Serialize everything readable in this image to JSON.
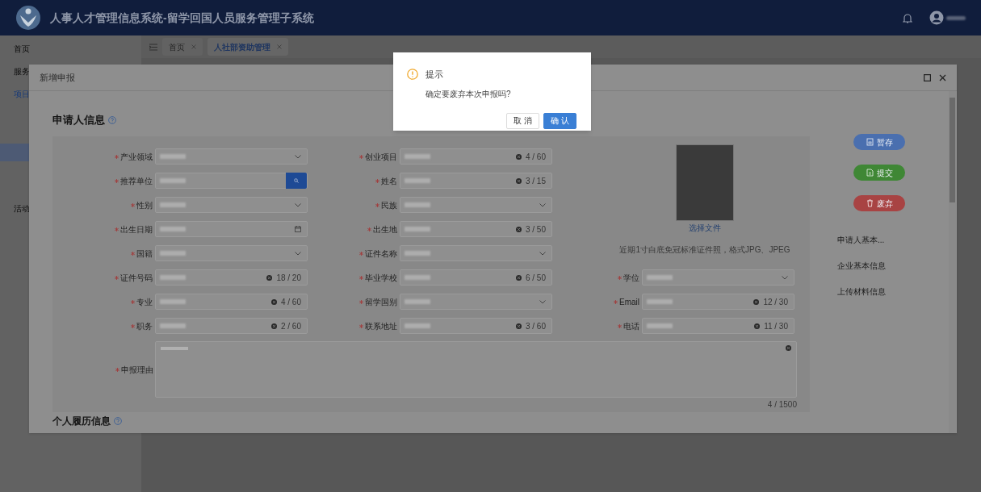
{
  "header": {
    "title": "人事人才管理信息系统-留学回国人员服务管理子系统"
  },
  "sidebar": {
    "items": [
      {
        "label": "首页",
        "selected": false
      },
      {
        "label": "服务",
        "selected": false
      },
      {
        "label": "项目",
        "selected": true
      },
      {
        "label": "活动",
        "selected": false
      }
    ]
  },
  "tabs": [
    {
      "label": "首页",
      "selected": false
    },
    {
      "label": "人社部资助管理",
      "selected": true
    }
  ],
  "dialog": {
    "title": "新增申报",
    "section": {
      "title": "申请人信息"
    },
    "columns": [
      [
        {
          "label": "产业领域",
          "kind": "select",
          "required": true
        },
        {
          "label": "推荐单位",
          "kind": "search",
          "required": true
        },
        {
          "label": "性别",
          "kind": "select",
          "required": true
        },
        {
          "label": "出生日期",
          "kind": "date",
          "required": true
        },
        {
          "label": "国籍",
          "kind": "select",
          "required": true
        },
        {
          "label": "证件号码",
          "kind": "text",
          "required": true,
          "count": "18 / 20"
        },
        {
          "label": "专业",
          "kind": "text",
          "required": true,
          "count": "4 / 60"
        },
        {
          "label": "职务",
          "kind": "text",
          "required": true,
          "count": "2 / 60"
        }
      ],
      [
        {
          "label": "创业项目",
          "kind": "text",
          "required": true,
          "count": "4 / 60"
        },
        {
          "label": "姓名",
          "kind": "text",
          "required": true,
          "count": "3 / 15"
        },
        {
          "label": "民族",
          "kind": "select",
          "required": true
        },
        {
          "label": "出生地",
          "kind": "text",
          "required": true,
          "count": "3 / 50"
        },
        {
          "label": "证件名称",
          "kind": "select",
          "required": true
        },
        {
          "label": "毕业学校",
          "kind": "text",
          "required": true,
          "count": "6 / 50"
        },
        {
          "label": "留学国别",
          "kind": "select",
          "required": true
        },
        {
          "label": "联系地址",
          "kind": "text",
          "required": true,
          "count": "3 / 60"
        }
      ],
      [
        {
          "label": "学位",
          "kind": "select",
          "required": true
        },
        {
          "label": "Email",
          "kind": "text",
          "required": true,
          "count": "12 / 30"
        },
        {
          "label": "电话",
          "kind": "text",
          "required": true,
          "count": "11 / 30"
        }
      ]
    ],
    "photo": {
      "link": "选择文件",
      "hint": "近期1寸白底免冠标准证件照，格式JPG、JPEG"
    },
    "reason": {
      "label": "申报理由",
      "required": true,
      "count": "4 / 1500"
    },
    "next_section": {
      "title": "个人履历信息"
    },
    "actions": [
      {
        "label": "暂存",
        "kind": "save"
      },
      {
        "label": "提交",
        "kind": "submit"
      },
      {
        "label": "废弃",
        "kind": "discard"
      }
    ],
    "anchors": [
      "申请人基本...",
      "企业基本信息",
      "上传材料信息"
    ]
  },
  "confirm": {
    "title": "提示",
    "message": "确定要废弃本次申报吗?",
    "buttons": [
      {
        "label": "取 消",
        "kind": "default"
      },
      {
        "label": "确 认",
        "kind": "primary"
      }
    ]
  }
}
